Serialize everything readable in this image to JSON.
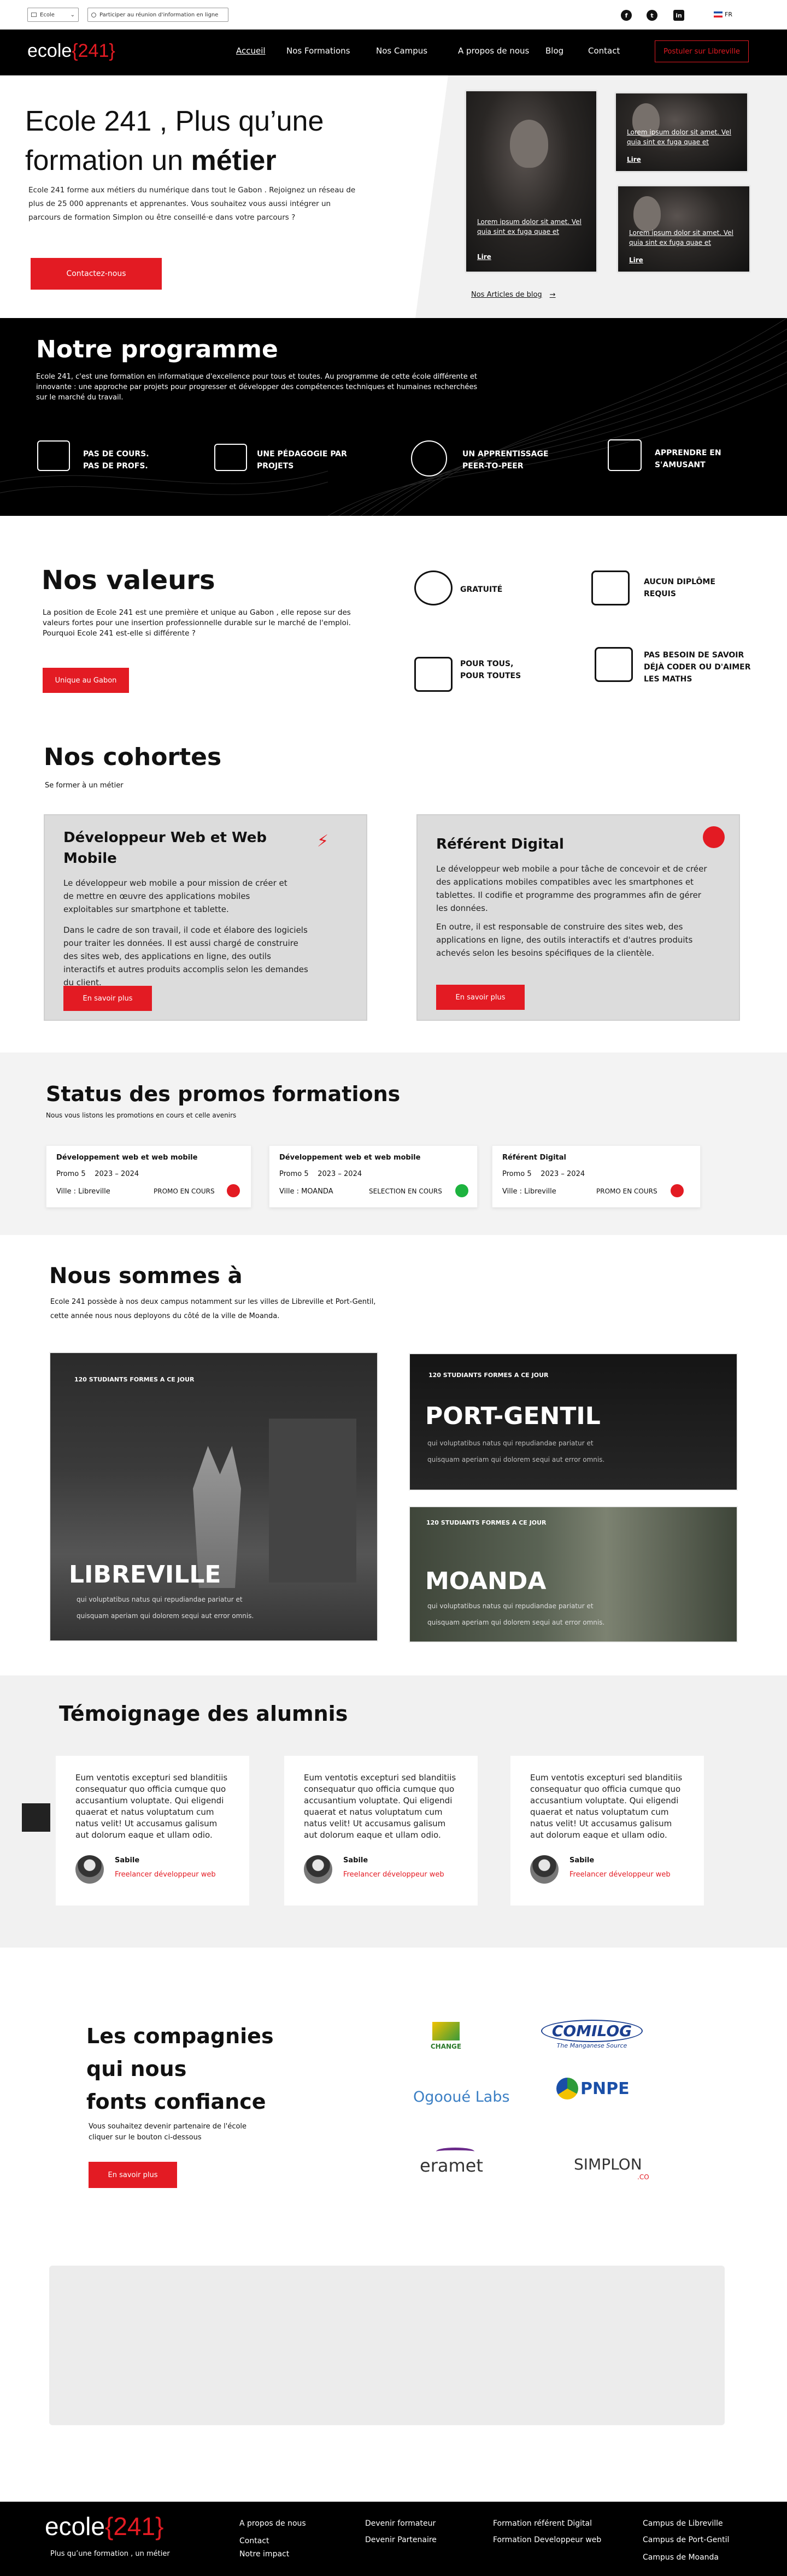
{
  "topbar": {
    "language_select": "Ecole",
    "search_placeholder": "Participer au réunion d'information en ligne",
    "lang": "FR"
  },
  "nav": {
    "logo_text": "ecole",
    "logo_number": "241",
    "items": [
      "Accueil",
      "Nos Formations",
      "Nos Campus",
      "A propos de nous",
      "Blog",
      "Contact"
    ],
    "cta": "Postuler sur Libreville"
  },
  "hero": {
    "title_1": "Ecole 241 , Plus qu’une",
    "title_2": "formation un ",
    "title_bold": "métier",
    "text": "Ecole 241 forme aux métiers du numérique dans tout le Gabon . Rejoignez un réseau de plus de 25 000 apprenants et apprenantes. Vous souhaitez vous aussi intégrer un parcours de formation Simplon ou être conseillé·e dans votre parcours ?",
    "button": "Contactez-nous",
    "blog_card_text": "Lorem ipsum dolor sit amet. Vel quia sint ex fuga quae et",
    "blog_card_link": "Lire",
    "blog_link": "Nos Articles de blog"
  },
  "programme": {
    "title": "Notre programme",
    "text": "Ecole 241, c'est une formation en informatique d'excellence pour tous et toutes. Au programme de cette école différente et innovante : une approche par projets pour progresser et développer des compétences techniques et humaines recherchées sur le marché du travail.",
    "features": [
      {
        "l1": "PAS DE COURS.",
        "l2": "PAS DE PROFS."
      },
      {
        "l1": "UNE PÉDAGOGIE PAR",
        "l2": "PROJETS"
      },
      {
        "l1": "UN APPRENTISSAGE",
        "l2": "PEER-TO-PEER"
      },
      {
        "l1": "APPRENDRE EN",
        "l2": "S'AMUSANT"
      }
    ]
  },
  "valeurs": {
    "title": "Nos valeurs",
    "text": "La position de Ecole 241 est une première et unique au Gabon , elle repose sur des valeurs fortes pour une insertion professionnelle durable sur le marché de l'emploi.",
    "question": "Pourquoi Ecole 241 est-elle si différente ?",
    "button": "Unique au Gabon",
    "items": [
      {
        "l1": "GRATUITÉ",
        "l2": "",
        "l3": ""
      },
      {
        "l1": "AUCUN DIPLÔME",
        "l2": "REQUIS",
        "l3": ""
      },
      {
        "l1": "POUR TOUS,",
        "l2": "POUR TOUTES",
        "l3": ""
      },
      {
        "l1": "PAS BESOIN DE SAVOIR",
        "l2": "DÉJÀ CODER OU D'AIMER",
        "l3": "LES MATHS"
      }
    ]
  },
  "cohortes": {
    "title": "Nos cohortes",
    "subtitle": "Se former à un métier",
    "cards": [
      {
        "title_1": "Développeur Web et Web",
        "title_2": "Mobile",
        "p1": "Le développeur web mobile a pour mission de créer et de mettre en œuvre des applications mobiles exploitables sur smartphone et tablette.",
        "p2": "Dans le cadre de son travail, il code et élabore des logiciels pour traiter les données. Il est aussi chargé de construire des sites web, des applications en ligne, des outils interactifs et autres produits accomplis selon les demandes du client.",
        "button": "En savoir plus"
      },
      {
        "title_1": "Référent Digital",
        "title_2": "",
        "p1": "Le développeur web mobile a pour tâche de concevoir et de créer des applications mobiles compatibles avec les smartphones et tablettes. Il codifie et programme des programmes afin de gérer les données.",
        "p2": "En outre, il est responsable de construire des sites web, des applications en ligne, des outils interactifs et d'autres produits achevés selon les besoins spécifiques de la clientèle.",
        "button": "En savoir plus"
      }
    ]
  },
  "status": {
    "title": "Status des promos formations",
    "subtitle": "Nous vous listons les promotions en cours et celle avenirs",
    "promos": [
      {
        "title": "Développement web et web mobile",
        "promo": "Promo 5",
        "years": "2023 – 2024",
        "ville": "Ville : Libreville",
        "state": "PROMO EN  COURS",
        "color": "#e31b23"
      },
      {
        "title": "Développement web et web mobile",
        "promo": "Promo 5",
        "years": "2023 – 2024",
        "ville": "Ville : MOANDA",
        "state": "SELECTION EN COURS",
        "color": "#1db33f"
      },
      {
        "title": "Référent Digital",
        "promo": "Promo 5",
        "years": "2023 – 2024",
        "ville": "Ville : Libreville",
        "state": "PROMO EN  COURS",
        "color": "#e31b23"
      }
    ]
  },
  "campus": {
    "title": "Nous sommes à",
    "text": "Ecole 241 possède à nos deux campus notamment sur les villes de Libreville et Port-Gentil, cette année nous nous deployons du côté de la ville de Moanda.",
    "cards": [
      {
        "small": "120 STUDIANTS FORMES A CE JOUR",
        "name": "LIBREVILLE",
        "d1": "qui voluptatibus natus qui repudiandae pariatur et",
        "d2": "quisquam aperiam qui dolorem sequi aut error omnis."
      },
      {
        "small": "120 STUDIANTS FORMES A CE JOUR",
        "name": "PORT-GENTIL",
        "d1": "qui voluptatibus natus qui repudiandae pariatur et",
        "d2": "quisquam aperiam qui dolorem sequi aut error omnis."
      },
      {
        "small": "120 STUDIANTS FORMES A CE JOUR",
        "name": "MOANDA",
        "d1": "qui voluptatibus natus qui repudiandae pariatur et",
        "d2": "quisquam aperiam qui dolorem sequi aut error omnis."
      }
    ]
  },
  "temoignage": {
    "title": "Témoignage des alumnis",
    "quote": "Eum ventotis excepturi sed blanditiis consequatur quo officia cumque quo accusantium voluptate. Qui eligendi quaerat et natus voluptatum cum natus velit! Ut accusamus galisum aut dolorum eaque et ullam odio.",
    "name": "Sabile",
    "role": "Freelancer développeur web"
  },
  "partners": {
    "title_1": "Les compagnies",
    "title_2": "qui nous",
    "title_3": "fonts confiance",
    "text": "Vous souhaitez devenir partenaire de l'école cliquer sur le bouton ci-dessous",
    "button": "En savoir plus",
    "logos": [
      "CHANGE",
      "COMILOG",
      "The Manganese Source",
      "Ogooué Labs",
      "PNPE",
      "eramet",
      "SIMPLON",
      ".CO"
    ]
  },
  "footer": {
    "logo_text": "ecole",
    "logo_number": "241",
    "tagline": "Plus qu’une formation , un métier",
    "col1": [
      "A propos de nous",
      "Contact",
      "Notre impact"
    ],
    "col2": [
      "Devenir formateur",
      "Devenir Partenaire"
    ],
    "col3": [
      "Formation référent Digital",
      "Formation Developpeur web"
    ],
    "col4": [
      "Campus de Libreville",
      "Campus de Port-Gentil",
      "Campus de Moanda"
    ]
  }
}
